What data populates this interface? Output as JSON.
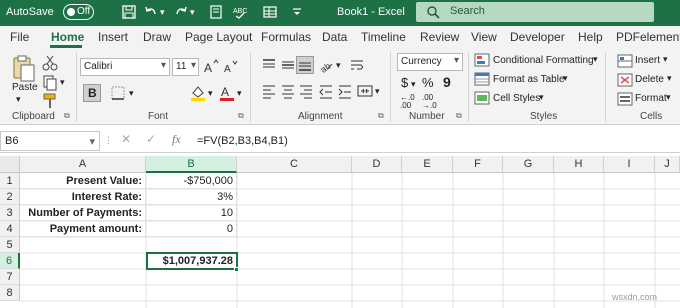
{
  "title_bar": {
    "autosave_label": "AutoSave",
    "autosave_state": "Off",
    "document_title": "Book1 - Excel",
    "search_placeholder": "Search"
  },
  "menu": {
    "tabs": [
      "File",
      "Home",
      "Insert",
      "Draw",
      "Page Layout",
      "Formulas",
      "Data",
      "Timeline",
      "Review",
      "View",
      "Developer",
      "Help",
      "PDFelement"
    ],
    "active": "Home"
  },
  "ribbon": {
    "clipboard": {
      "paste_label": "Paste",
      "group_label": "Clipboard"
    },
    "font": {
      "font_name": "Calibri",
      "font_size": "11",
      "bold_label": "B",
      "group_label": "Font"
    },
    "alignment": {
      "group_label": "Alignment"
    },
    "number": {
      "format": "Currency",
      "dollar": "$",
      "percent": "%",
      "comma": "9",
      "inc_dec": "←.0 .00",
      "dec_dec": ".00 →.0",
      "group_label": "Number"
    },
    "styles": {
      "conditional": "Conditional Formatting",
      "format_table": "Format as Table",
      "cell_styles": "Cell Styles",
      "group_label": "Styles"
    },
    "cells": {
      "insert": "Insert",
      "delete": "Delete",
      "format": "Format",
      "group_label": "Cells"
    }
  },
  "formula_bar": {
    "name_box": "B6",
    "formula": "=FV(B2,B3,B4,B1)"
  },
  "sheet": {
    "columns": [
      "A",
      "B",
      "C",
      "D",
      "E",
      "F",
      "G",
      "H",
      "I",
      "J"
    ],
    "rows": [
      "1",
      "2",
      "3",
      "4",
      "5",
      "6",
      "7",
      "8"
    ],
    "cells": {
      "A1": "Present Value:",
      "B1": "-$750,000",
      "A2": "Interest Rate:",
      "B2": "3%",
      "A3": "Number of Payments:",
      "B3": "10",
      "A4": "Payment amount:",
      "B4": "0",
      "B6": "$1,007,937.28"
    }
  },
  "colors": {
    "accent": "#1e7145",
    "ribbon_bg": "#f3f3f3"
  },
  "watermark": "wsxdn.com"
}
